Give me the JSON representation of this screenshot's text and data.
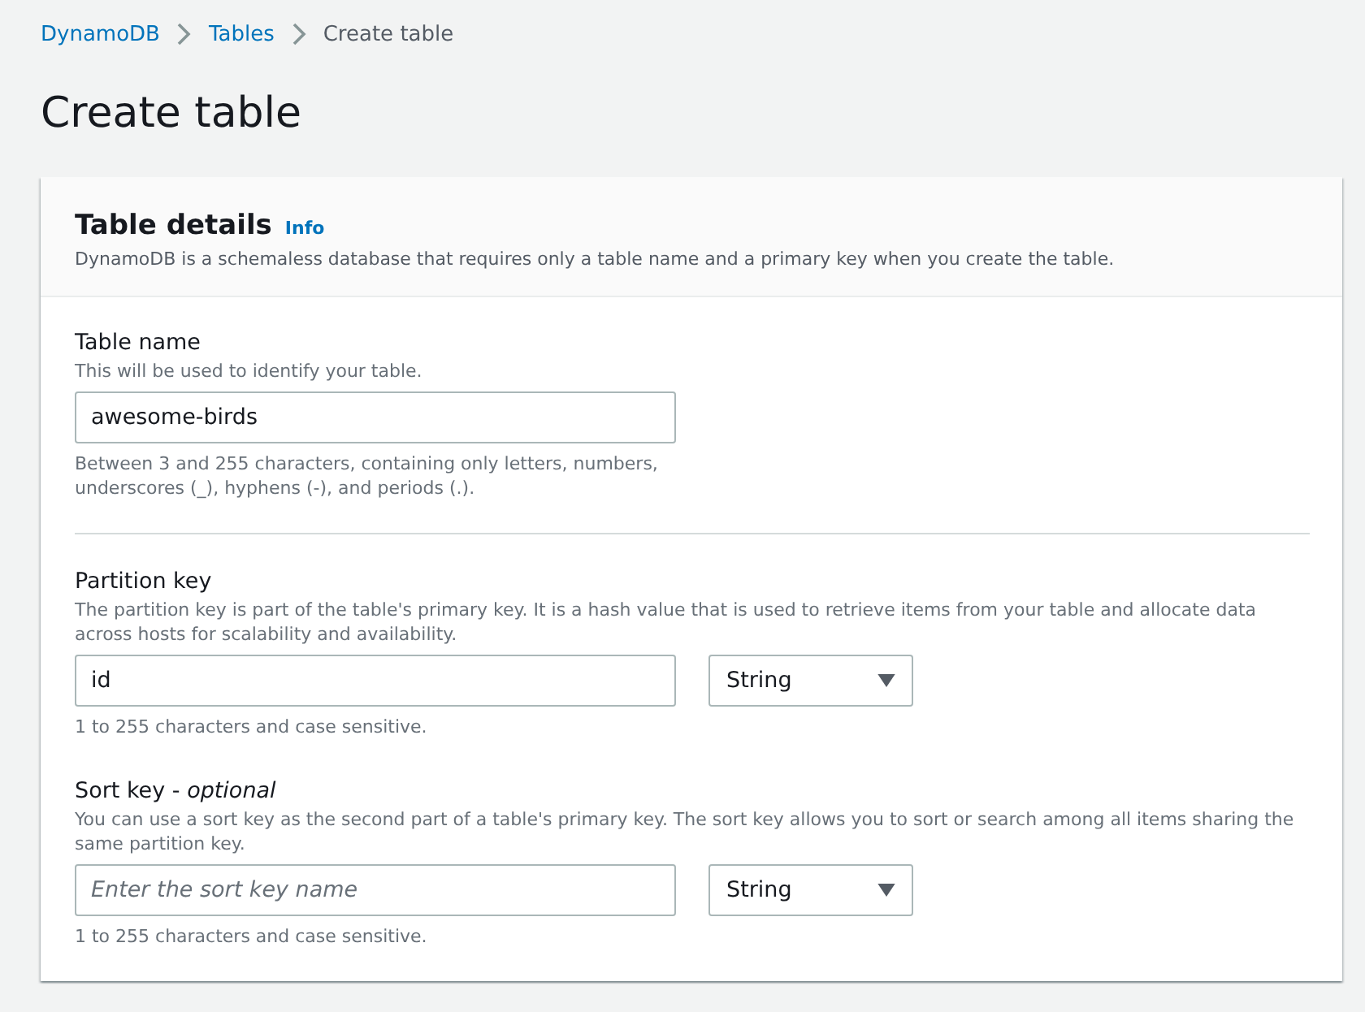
{
  "breadcrumb": [
    {
      "label": "DynamoDB",
      "kind": "link"
    },
    {
      "label": "Tables",
      "kind": "link"
    },
    {
      "label": "Create table",
      "kind": "current"
    }
  ],
  "page_title": "Create table",
  "panel": {
    "title": "Table details",
    "info": "Info",
    "description": "DynamoDB is a schemaless database that requires only a table name and a primary key when you create the table.",
    "groups": [
      {
        "fields": [
          {
            "label": "Table name",
            "description": "This will be used to identify your table.",
            "input": {
              "value": "awesome-birds"
            },
            "constraint": "Between 3 and 255 characters, containing only letters, numbers, underscores (_), hyphens (-), and periods (.)."
          }
        ]
      },
      {
        "fields": [
          {
            "label": "Partition key",
            "description": "The partition key is part of the table's primary key. It is a hash value that is used to retrieve items from your table and allocate data across hosts for scalability and availability.",
            "input": {
              "value": "id"
            },
            "type_select": {
              "value": "String"
            },
            "constraint": "1 to 255 characters and case sensitive."
          },
          {
            "label": "Sort key - *optional*",
            "description": "You can use a sort key as the second part of a table's primary key. The sort key allows you to sort or search among all items sharing the same partition key.",
            "input": {
              "placeholder": "Enter the sort key name"
            },
            "type_select": {
              "value": "String"
            },
            "constraint": "1 to 255 characters and case sensitive."
          }
        ]
      }
    ]
  }
}
